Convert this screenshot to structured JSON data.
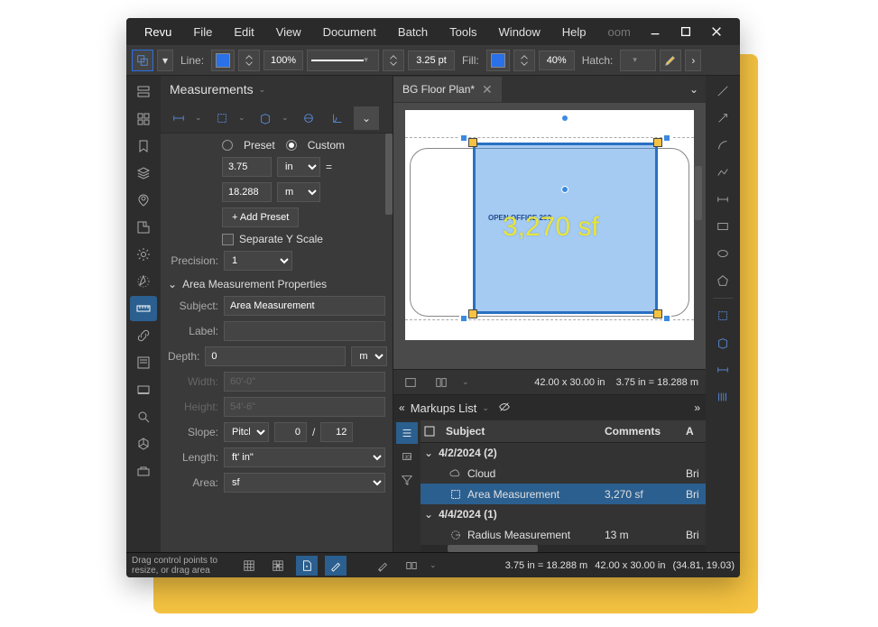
{
  "menubar": {
    "items": [
      "Revu",
      "File",
      "Edit",
      "View",
      "Document",
      "Batch",
      "Tools",
      "Window",
      "Help"
    ],
    "extra": "oom"
  },
  "top_toolbar": {
    "line_label": "Line:",
    "line_color": "#2a70e6",
    "percent": "100%",
    "pt_value": "3.25 pt",
    "fill_label": "Fill:",
    "fill_color": "#2a70e6",
    "opacity": "40%",
    "hatch_label": "Hatch:"
  },
  "left_panel": {
    "title": "Measurements",
    "preset_label": "Preset",
    "custom_label": "Custom",
    "scale_num": "3.75",
    "scale_unit1": "in",
    "eq": "=",
    "scale_out": "18.288",
    "scale_unit2": "m",
    "add_preset": "+ Add Preset",
    "separate_y": "Separate Y Scale",
    "precision_label": "Precision:",
    "precision_val": "1",
    "section": "Area Measurement Properties",
    "subject_label": "Subject:",
    "subject_val": "Area Measurement",
    "label_label": "Label:",
    "label_val": "",
    "depth_label": "Depth:",
    "depth_val": "0",
    "depth_unit": "m",
    "width_label": "Width:",
    "width_val": "60'-0\"",
    "height_label": "Height:",
    "height_val": "54'-6\"",
    "slope_label": "Slope:",
    "slope_unit": "Pitch",
    "slope_rise": "0",
    "slope_sep": "/",
    "slope_run": "12",
    "length_label": "Length:",
    "length_unit": "ft' in\"",
    "area_label": "Area:",
    "area_unit": "sf"
  },
  "document": {
    "tab_name": "BG Floor Plan*",
    "room_label": "OPEN OFFICE  26?",
    "area_text": "3,270 sf",
    "status_dim": "42.00 x 30.00 in",
    "status_scale": "3.75 in = 18.288 m"
  },
  "markups": {
    "title": "Markups List",
    "col_subject": "Subject",
    "col_comments": "Comments",
    "col_a": "A",
    "groups": [
      {
        "date": "4/2/2024 (2)",
        "rows": [
          {
            "icon": "cloud",
            "subject": "Cloud",
            "comments": "",
            "a": "Bri"
          },
          {
            "icon": "area",
            "subject": "Area Measurement",
            "comments": "3,270 sf",
            "a": "Bri",
            "selected": true
          }
        ]
      },
      {
        "date": "4/4/2024 (1)",
        "rows": [
          {
            "icon": "radius",
            "subject": "Radius Measurement",
            "comments": "13 m",
            "a": "Bri"
          }
        ]
      }
    ]
  },
  "status": {
    "hint": "Drag control points to resize, or drag area",
    "scale_text": "3.75 in = 18.288 m",
    "dim_text": "42.00 x 30.00 in",
    "coords": "(34.81, 19.03)"
  }
}
